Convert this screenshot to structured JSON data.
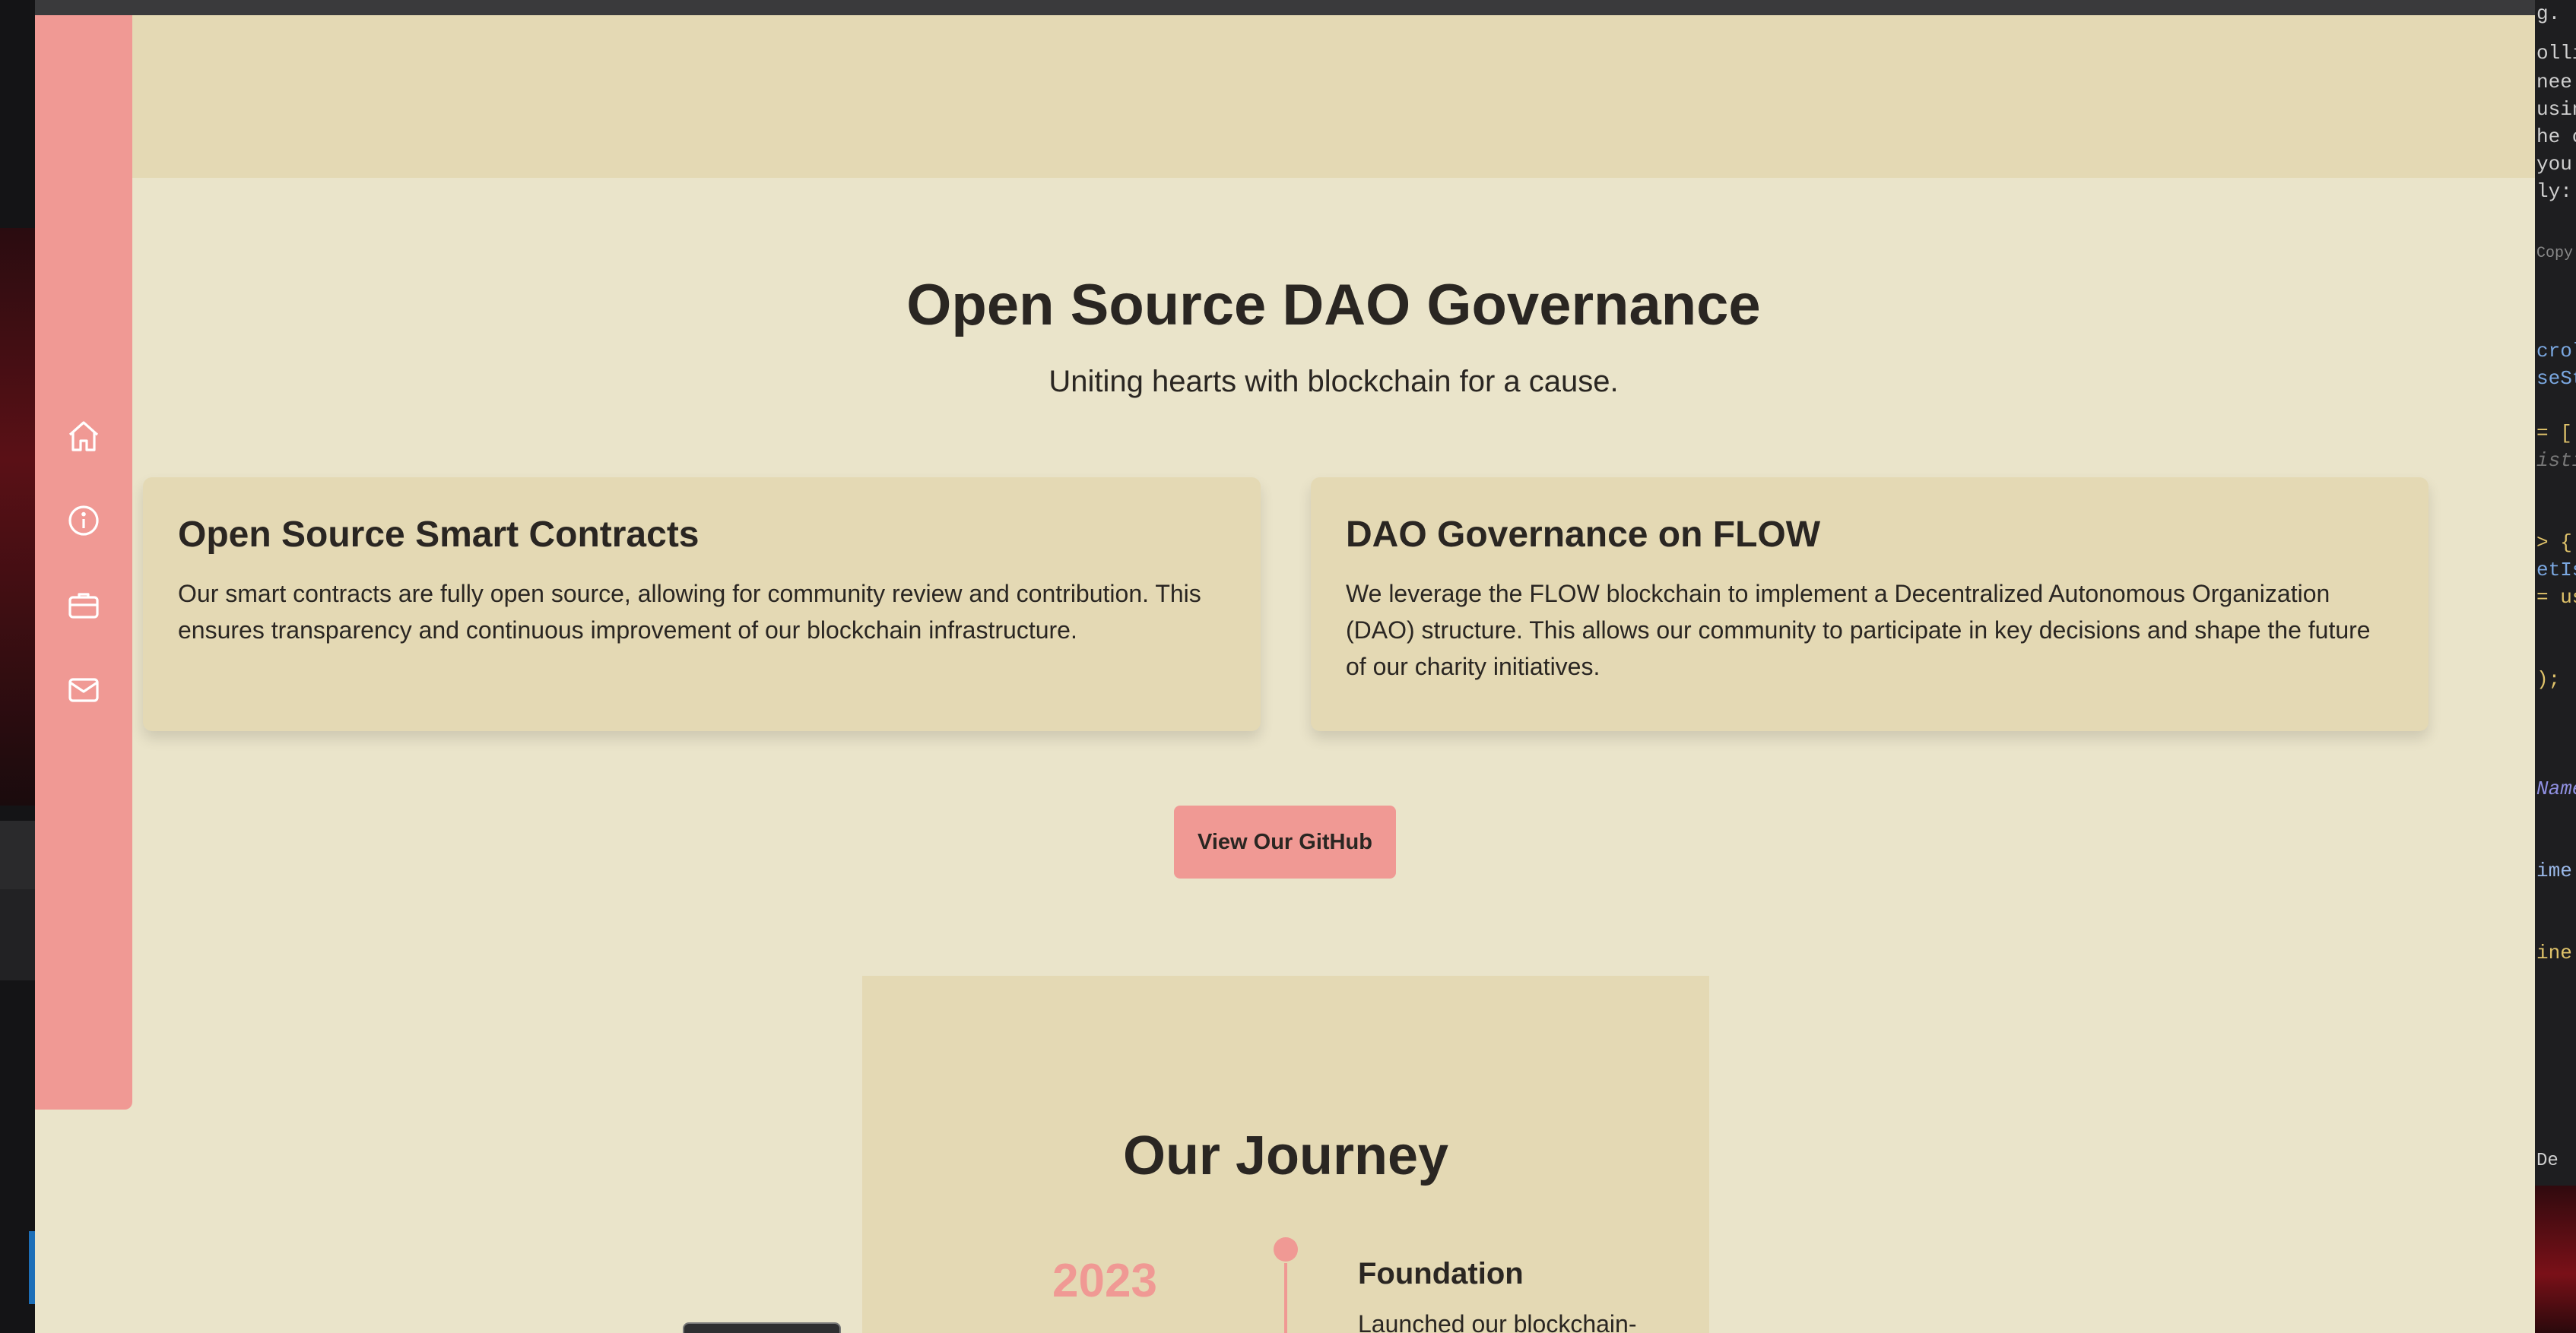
{
  "sidebar": {
    "items": [
      {
        "icon": "home-icon"
      },
      {
        "icon": "info-icon"
      },
      {
        "icon": "briefcase-icon"
      },
      {
        "icon": "mail-icon"
      }
    ]
  },
  "governance": {
    "title": "Open Source DAO Governance",
    "subtitle": "Uniting hearts with blockchain for a cause.",
    "cards": [
      {
        "title": "Open Source Smart Contracts",
        "text": "Our smart contracts are fully open source, allowing for community review and contribution. This ensures transparency and continuous improvement of our blockchain infrastructure."
      },
      {
        "title": "DAO Governance on FLOW",
        "text": "We leverage the FLOW blockchain to implement a Decentralized Autonomous Organization (DAO) structure. This allows our community to participate in key decisions and shape the future of our charity initiatives."
      }
    ],
    "button_label": "View Our GitHub"
  },
  "journey": {
    "title": "Our Journey",
    "milestones": [
      {
        "year": "2023",
        "title": "Foundation",
        "description": "Launched our blockchain-"
      }
    ]
  },
  "background_editor": {
    "lines": [
      "g.",
      "ollin",
      "nee",
      "usin",
      "he c",
      "you",
      "ly:",
      "Copy",
      "crol",
      "seSt",
      "= [",
      "isti",
      "> {",
      "etIs",
      "= us",
      ");",
      "Name",
      "ime",
      "ine",
      "De"
    ]
  },
  "colors": {
    "sidebar": "#f09994",
    "band": "#e4d9b4",
    "page": "#eae4ca",
    "accent": "#f09994",
    "progress": "#a7d3bf",
    "text": "#2a2622"
  }
}
